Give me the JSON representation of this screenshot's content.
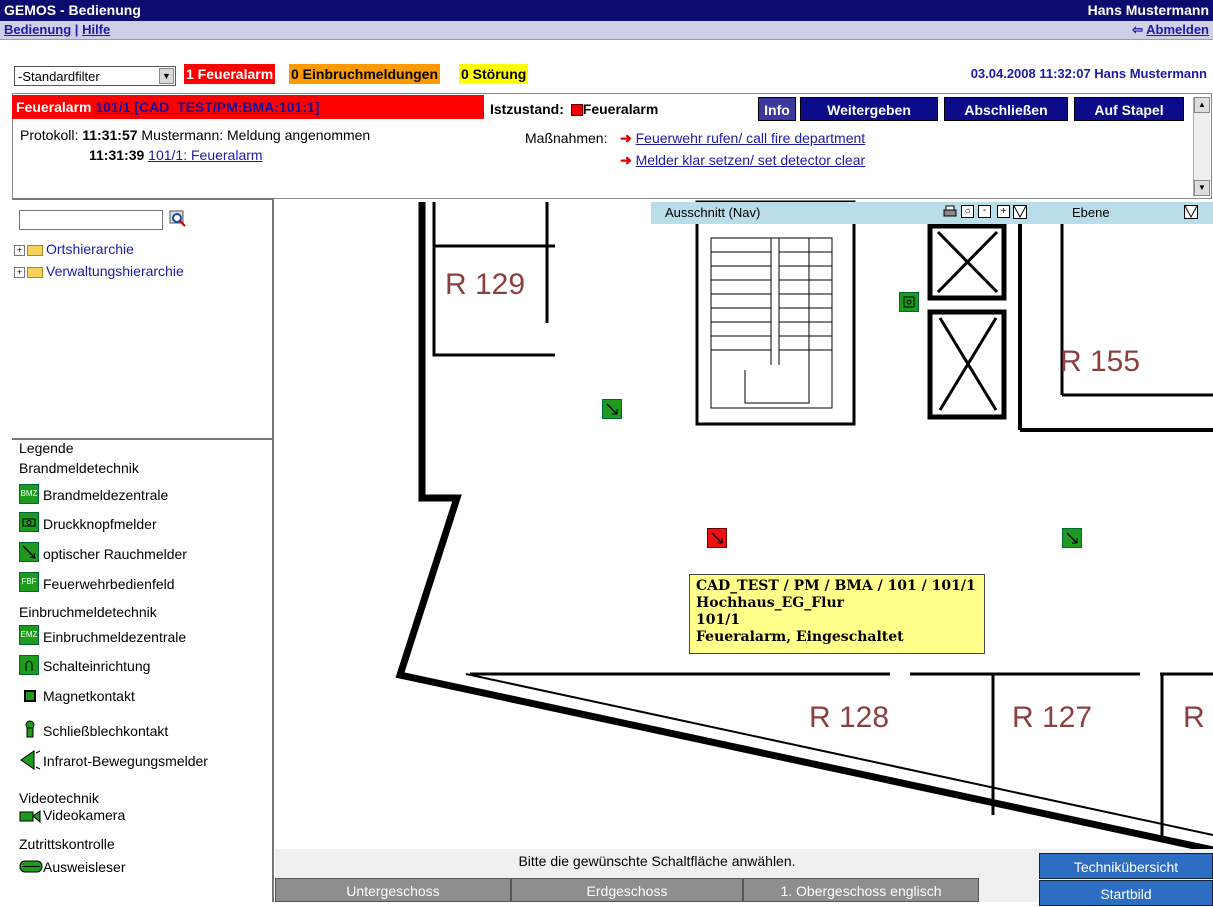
{
  "window": {
    "title": "GEMOS - Bedienung",
    "user": "Hans Mustermann"
  },
  "menu": {
    "bedienung": "Bedienung",
    "sep": "|",
    "hilfe": "Hilfe",
    "logout": "Abmelden"
  },
  "filter": {
    "selected": "-Standardfilter"
  },
  "badges": {
    "fire": "1 Feueralarm",
    "intrusion": "0 Einbruchmeldungen",
    "fault": "0 Störung"
  },
  "datetime": "03.04.2008 11:32:07 Hans Mustermann",
  "alarm": {
    "title_prefix": "Feueralarm",
    "title_link": "101/1 [CAD_TEST/PM:BMA:101:1]",
    "state_label": "Istzustand:",
    "state_value": "Feueralarm",
    "buttons": {
      "info": "Info",
      "forward": "Weitergeben",
      "close": "Abschließen",
      "stack": "Auf Stapel"
    },
    "protocol_label": "Protokoll:",
    "protocol": [
      {
        "time": "11:31:57",
        "text": "Mustermann: Meldung angenommen"
      },
      {
        "time": "11:31:39",
        "link": "101/1: Feueralarm"
      }
    ],
    "measures_label": "Maßnahmen:",
    "measures": [
      "Feuerwehr rufen/ call fire department",
      "Melder klar setzen/ set detector clear"
    ]
  },
  "tree": {
    "items": [
      "Ortshierarchie",
      "Verwaltungshierarchie"
    ]
  },
  "legend": {
    "title": "Legende",
    "groups": [
      {
        "name": "Brandmeldetechnik",
        "items": [
          "Brandmeldezentrale",
          "Druckknopfmelder",
          "optischer Rauchmelder",
          "Feuerwehrbedienfeld"
        ]
      },
      {
        "name": "Einbruchmeldetechnik",
        "items": [
          "Einbruchmeldezentrale",
          "Schalteinrichtung",
          "Magnetkontakt",
          "Schließblechkontakt",
          "Infrarot-Bewegungsmelder"
        ]
      },
      {
        "name": "Videotechnik",
        "items": [
          "Videokamera"
        ]
      },
      {
        "name": "Zutrittskontrolle",
        "items": [
          "Ausweisleser"
        ]
      }
    ],
    "icon_texts": {
      "bmz": "BMZ",
      "fbf": "FBF",
      "emz": "EMZ"
    }
  },
  "nav": {
    "label": "Ausschnitt (Nav)",
    "layer": "Ebene"
  },
  "rooms": {
    "r129": "R 129",
    "r155": "R 155",
    "r128": "R 128",
    "r127": "R 127",
    "rpartial": "R"
  },
  "tooltip": {
    "line1": "CAD_TEST / PM / BMA / 101 / 101/1",
    "line2": "Hochhaus_EG_Flur",
    "line3": "101/1",
    "line4": "Feueralarm, Eingeschaltet"
  },
  "bottom": {
    "prompt": "Bitte die gewünschte Schaltfläche anwählen.",
    "floors": [
      "Untergeschoss",
      "Erdgeschoss",
      "1. Obergeschoss englisch"
    ],
    "side": [
      "Technikübersicht",
      "Startbild"
    ]
  },
  "colors": {
    "titlebar": "#0c0c6e",
    "alarm_red": "#ff0000",
    "badge_orange": "#ff9900",
    "badge_yellow": "#ffff00",
    "detector_green": "#1e9a1e",
    "nav_blue": "#b9dde9",
    "side_btn": "#2e6ec2"
  }
}
